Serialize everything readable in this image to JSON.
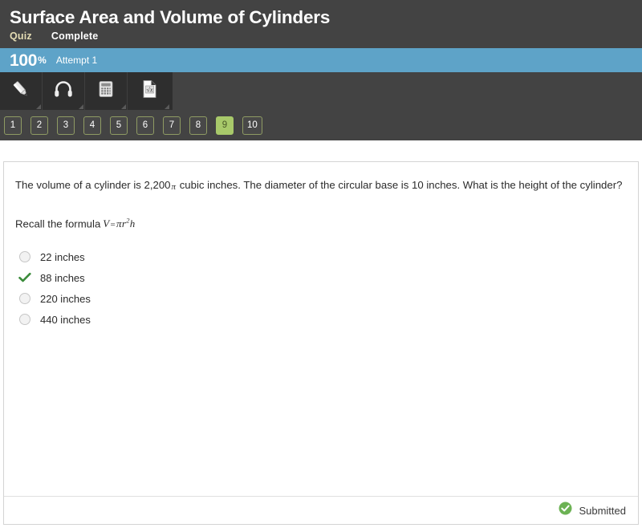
{
  "header": {
    "title": "Surface Area and Volume of Cylinders",
    "type_label": "Quiz",
    "status_label": "Complete",
    "accent_cream": "#e4dcb4"
  },
  "score": {
    "percent": "100",
    "percent_symbol": "%",
    "attempt_label": "Attempt 1",
    "bar_color": "#5ea3c8"
  },
  "toolbar": {
    "tools": [
      {
        "name": "pencil-icon",
        "label": "Pencil"
      },
      {
        "name": "headphones-icon",
        "label": "Headphones"
      },
      {
        "name": "calculator-icon",
        "label": "Calculator"
      },
      {
        "name": "formula-icon",
        "label": "Formula Sheet"
      }
    ]
  },
  "question_nav": {
    "items": [
      {
        "label": "1",
        "active": false
      },
      {
        "label": "2",
        "active": false
      },
      {
        "label": "3",
        "active": false
      },
      {
        "label": "4",
        "active": false
      },
      {
        "label": "5",
        "active": false
      },
      {
        "label": "6",
        "active": false
      },
      {
        "label": "7",
        "active": false
      },
      {
        "label": "8",
        "active": false
      },
      {
        "label": "9",
        "active": true
      },
      {
        "label": "10",
        "active": false
      }
    ],
    "active_color": "#a8c96a"
  },
  "question": {
    "text_part1": "The volume of a cylinder is 2,200",
    "math_pi": "π",
    "text_part2": " cubic inches. The diameter of the circular base is 10 inches. What is the height of the cylinder?",
    "recall_label": "Recall the formula",
    "formula_v": "V",
    "formula_eq": "=",
    "formula_pi": "π",
    "formula_r": "r",
    "formula_exp": "2",
    "formula_h": "h",
    "options": [
      {
        "label": "22 inches",
        "selected": false
      },
      {
        "label": "88 inches",
        "selected": true
      },
      {
        "label": "220 inches",
        "selected": false
      },
      {
        "label": "440 inches",
        "selected": false
      }
    ],
    "selected_color": "#3a8b3a"
  },
  "footer": {
    "status_label": "Submitted",
    "status_color": "#6cb254"
  }
}
